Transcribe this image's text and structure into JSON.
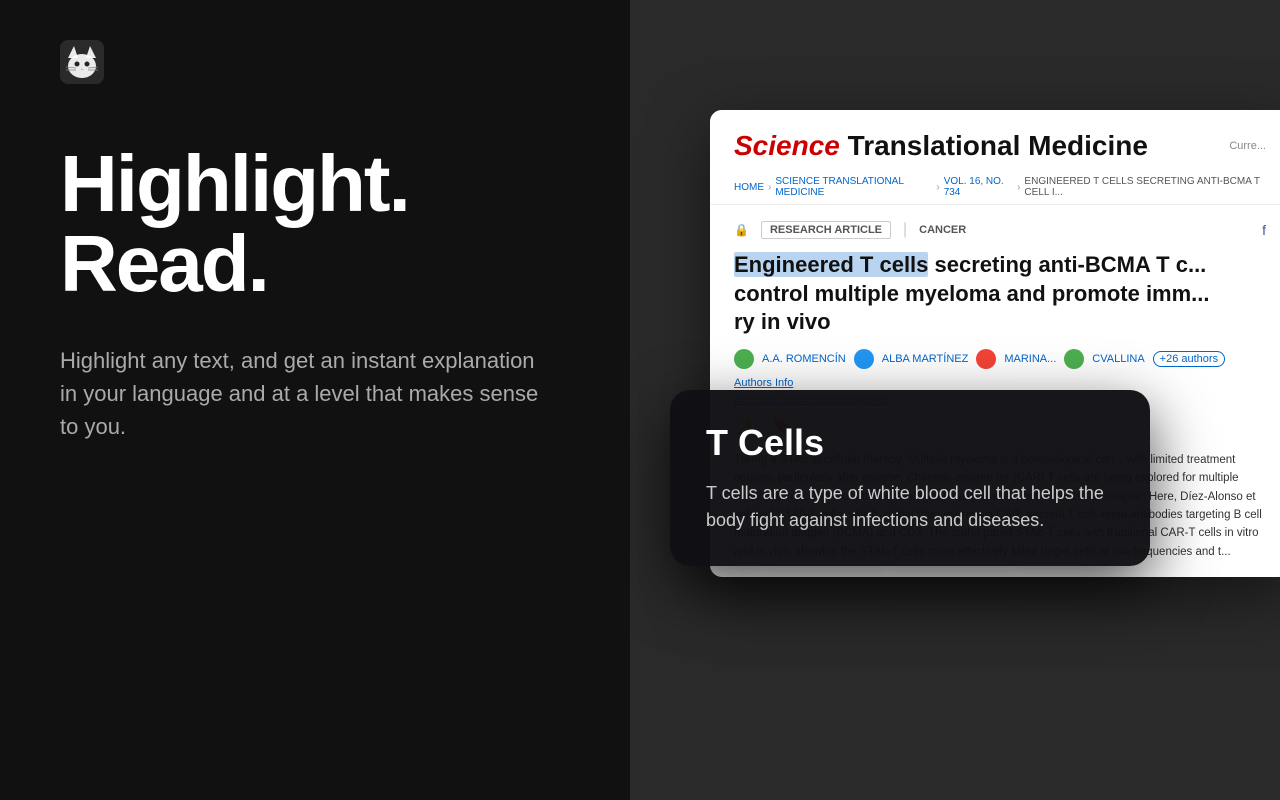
{
  "left": {
    "logo_alt": "App logo - cat face",
    "hero_title_line1": "Highlight.",
    "hero_title_line2": "Read.",
    "subtitle": "Highlight any text, and get an instant explanation in your language and at a level that makes sense to you."
  },
  "right": {
    "article": {
      "journal_science": "Science",
      "journal_rest": " Translational Medicine",
      "journal_extra": "Curre...",
      "breadcrumb": [
        "HOME",
        "SCIENCE TRANSLATIONAL MEDICINE",
        "VOL. 16, NO. 734",
        "ENGINEERED T CELLS SECRETING ANTI-BCMA T CELL I..."
      ],
      "tag_research": "RESEARCH ARTICLE",
      "tag_separator": "|",
      "tag_cancer": "CANCER",
      "article_title_highlighted": "Engineered T cells",
      "article_title_rest": " secreting anti-BCMA T c... control multiple myeloma and promote imm... ry in vivo",
      "authors": [
        "A.A. ROMENCÍN",
        "ALBA MARTÍNEZ",
        "MARINA...",
        "CVALLINA"
      ],
      "more_authors": "+26 authors",
      "authors_info": "Authors Info",
      "doi": "doi.org/1126/scitranslmed.adg7962",
      "abstract": "Taking a STAb at cellular therapy. Multiple myeloma is a hematological can... with limited treatment options, particularly after relapse. Chimeric antigen tor (CAR) T cells are being explored for multiple myeloma, much like for oth hematological malignancies, but patients still relapse. Here, Díez-Alonso et veloped STAb-T cells, which, rather than express a CAR, secrete T cell–enga antibodies targeting B cell maturation antigen (BCMA) and CD3. The autho pared STAb-T cells with traditional CAR-T cells in vitro and in vivo, showing the STAb-T cells more effectively killed target cells at low frequencies and t..."
    },
    "popup": {
      "term": "T Cells",
      "definition": "T cells are a type of white blood cell that helps the body fight against infections and diseases."
    }
  }
}
